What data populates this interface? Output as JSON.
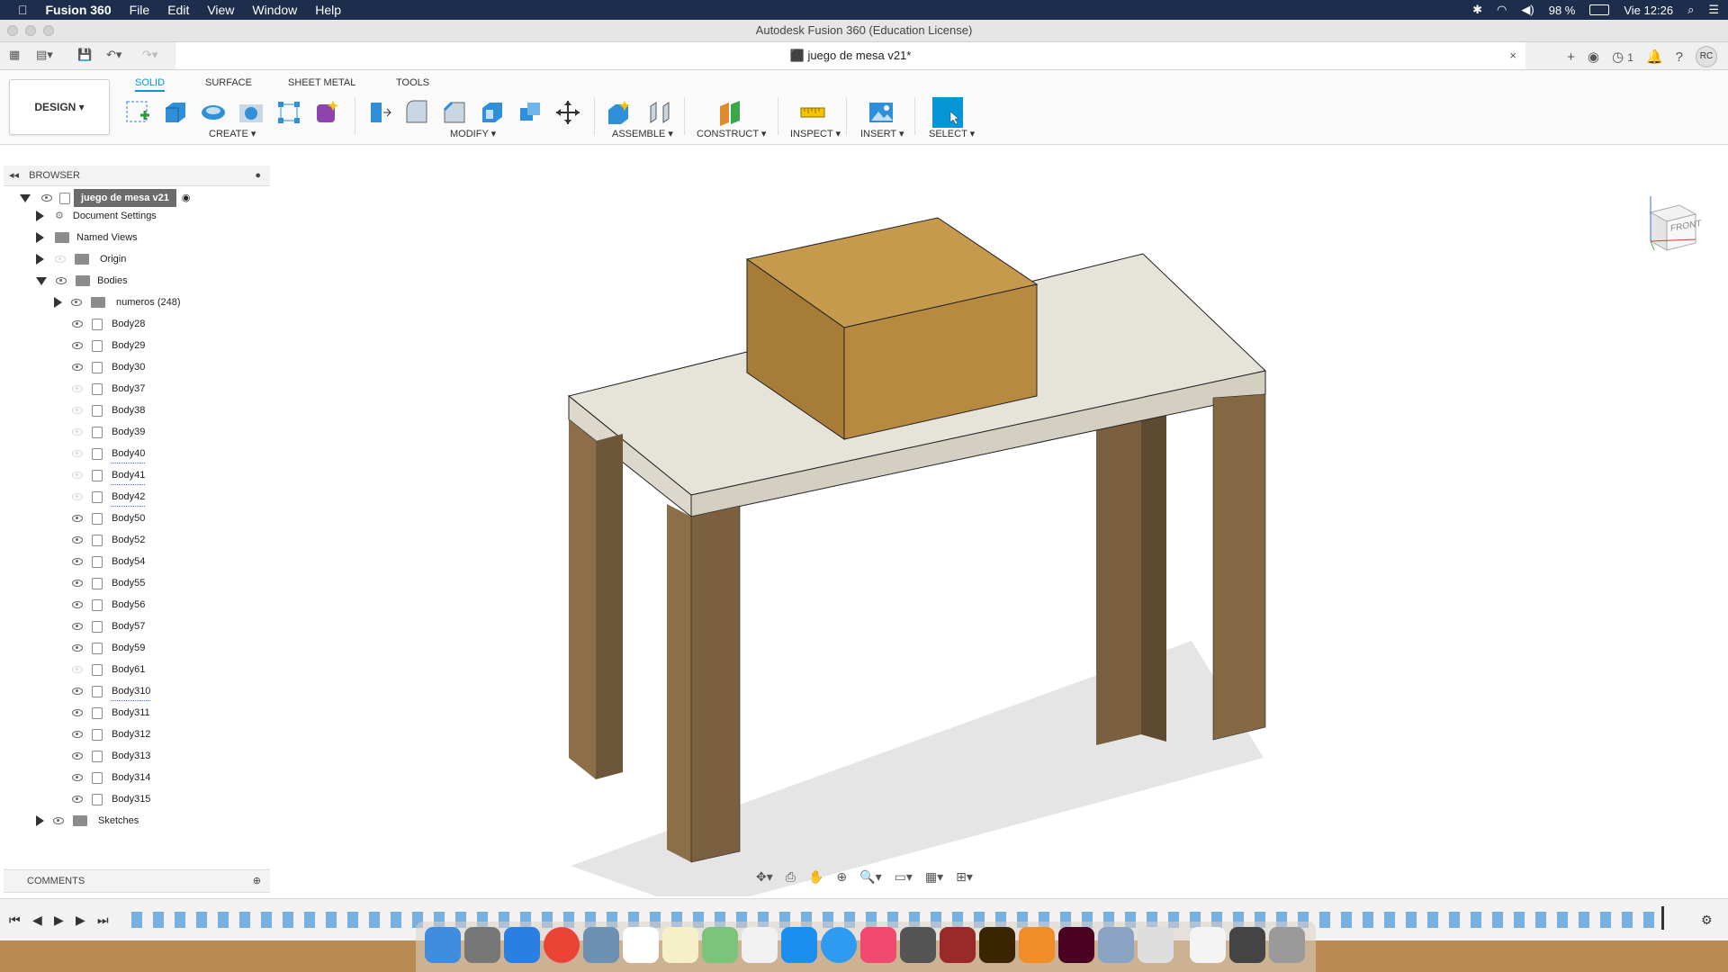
{
  "menubar": {
    "app": "Fusion 360",
    "items": [
      "File",
      "Edit",
      "View",
      "Window",
      "Help"
    ],
    "battery": "98 %",
    "clock": "Vie 12:26"
  },
  "window": {
    "title": "Autodesk Fusion 360 (Education License)"
  },
  "doc_tab": {
    "title": "juego de mesa v21*",
    "close": "×"
  },
  "tabbar": {
    "notifications": "1",
    "avatar": "RC"
  },
  "ribbon": {
    "workspace": "DESIGN",
    "tabs": [
      "SOLID",
      "SURFACE",
      "SHEET METAL",
      "TOOLS"
    ],
    "groups": [
      "CREATE",
      "MODIFY",
      "ASSEMBLE",
      "CONSTRUCT",
      "INSPECT",
      "INSERT",
      "SELECT"
    ]
  },
  "browser": {
    "title": "BROWSER",
    "root": "juego de mesa v21",
    "items": [
      {
        "label": "Document Settings",
        "type": "settings"
      },
      {
        "label": "Named Views",
        "type": "folder"
      },
      {
        "label": "Origin",
        "type": "folder"
      },
      {
        "label": "Bodies",
        "type": "folder"
      },
      {
        "label": "numeros (248)",
        "type": "folder"
      }
    ],
    "bodies": [
      "Body28",
      "Body29",
      "Body30",
      "Body37",
      "Body38",
      "Body39",
      "Body40",
      "Body41",
      "Body42",
      "Body50",
      "Body52",
      "Body54",
      "Body55",
      "Body56",
      "Body57",
      "Body59",
      "Body61",
      "Body310",
      "Body311",
      "Body312",
      "Body313",
      "Body314",
      "Body315"
    ],
    "sketches": "Sketches"
  },
  "comments": {
    "title": "COMMENTS"
  },
  "viewcube": {
    "face": "FRONT"
  },
  "colors": {
    "accent": "#0696d7",
    "menubar": "#1d2d4c"
  }
}
